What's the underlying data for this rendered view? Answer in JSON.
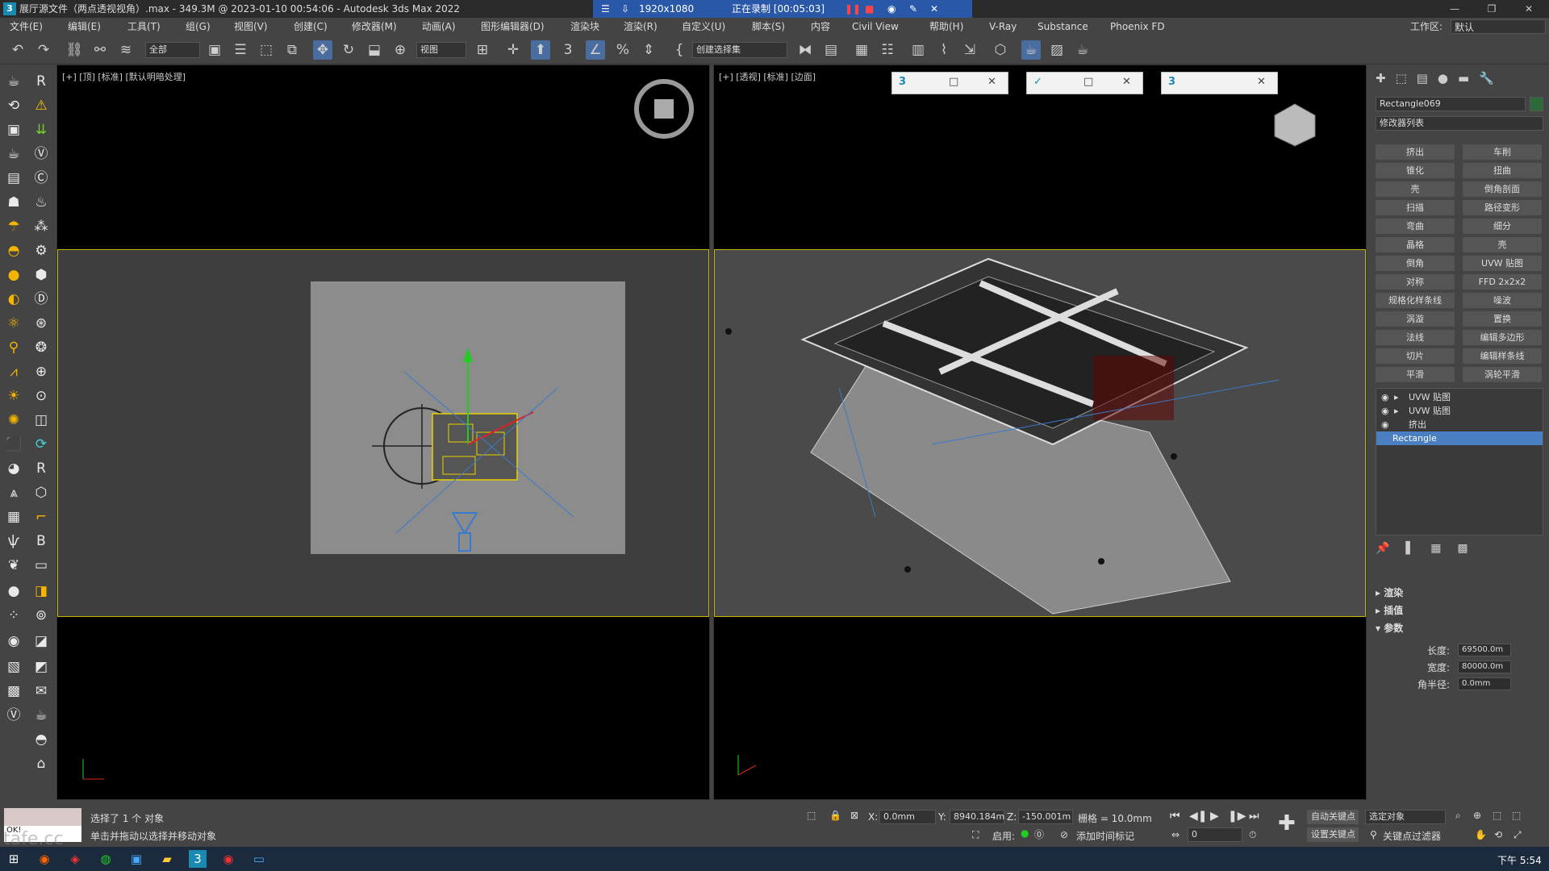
{
  "title": {
    "app_icon": "3",
    "text": "展厅源文件（两点透视视角）.max - 349.3M @ 2023-01-10 00:54:06 - Autodesk 3ds Max 2022",
    "resolution": "1920x1080",
    "recording": "正在录制 [00:05:03]"
  },
  "menu": [
    "文件(E)",
    "编辑(E)",
    "工具(T)",
    "组(G)",
    "视图(V)",
    "创建(C)",
    "修改器(M)",
    "动画(A)",
    "图形编辑器(D)",
    "渲染块",
    "渲染(R)",
    "自定义(U)",
    "脚本(S)",
    "内容",
    "Civil View",
    "帮助(H)",
    "V-Ray",
    "Substance",
    "Phoenix FD"
  ],
  "workspace": {
    "label": "工作区:",
    "value": "默认"
  },
  "toolbar": {
    "filter": "全部",
    "view": "视图",
    "selection_set": "创建选择集"
  },
  "viewports": {
    "top_label": "[+] [顶] [标准] [默认明暗处理]",
    "persp_label": "[+] [透视] [标准] [边面]"
  },
  "floating_windows": [
    {
      "icon": "3"
    },
    {
      "icon": "✓"
    },
    {
      "icon": "3"
    }
  ],
  "panel": {
    "object_name": "Rectangle069",
    "modifier_list": "修改器列表",
    "modifier_buttons": [
      "挤出",
      "车削",
      "锥化",
      "扭曲",
      "壳",
      "倒角剖面",
      "扫描",
      "路径变形",
      "弯曲",
      "细分",
      "晶格",
      "壳",
      "倒角",
      "UVW 贴图",
      "对称",
      "FFD 2x2x2",
      "规格化样条线",
      "噪波",
      "涡漩",
      "置换",
      "法线",
      "编辑多边形",
      "切片",
      "编辑样条线",
      "平滑",
      "涡轮平滑"
    ],
    "stack": [
      "UVW 贴图",
      "UVW 贴图",
      "挤出",
      "Rectangle"
    ],
    "rollouts": [
      "渲染",
      "插值",
      "参数"
    ],
    "params": [
      {
        "label": "长度:",
        "value": "69500.0m"
      },
      {
        "label": "宽度:",
        "value": "80000.0m"
      },
      {
        "label": "角半径:",
        "value": "0.0mm"
      }
    ]
  },
  "status": {
    "line1": "选择了 1 个 对象",
    "line2": "单击并拖动以选择并移动对象",
    "x": "0.0mm",
    "y": "8940.184m",
    "z": "-150.001m",
    "grid": "栅格 = 10.0mm",
    "enable": "启用:",
    "add_time_tag": "添加时间标记",
    "auto_key": "自动关键点",
    "set_key": "设置关键点",
    "selected_obj": "选定对象",
    "key_filter": "关键点过滤器",
    "frame": "0",
    "script_listener": "OK!",
    "watermark": "tafe.cc"
  },
  "taskbar": {
    "time": "下午 5:54"
  }
}
